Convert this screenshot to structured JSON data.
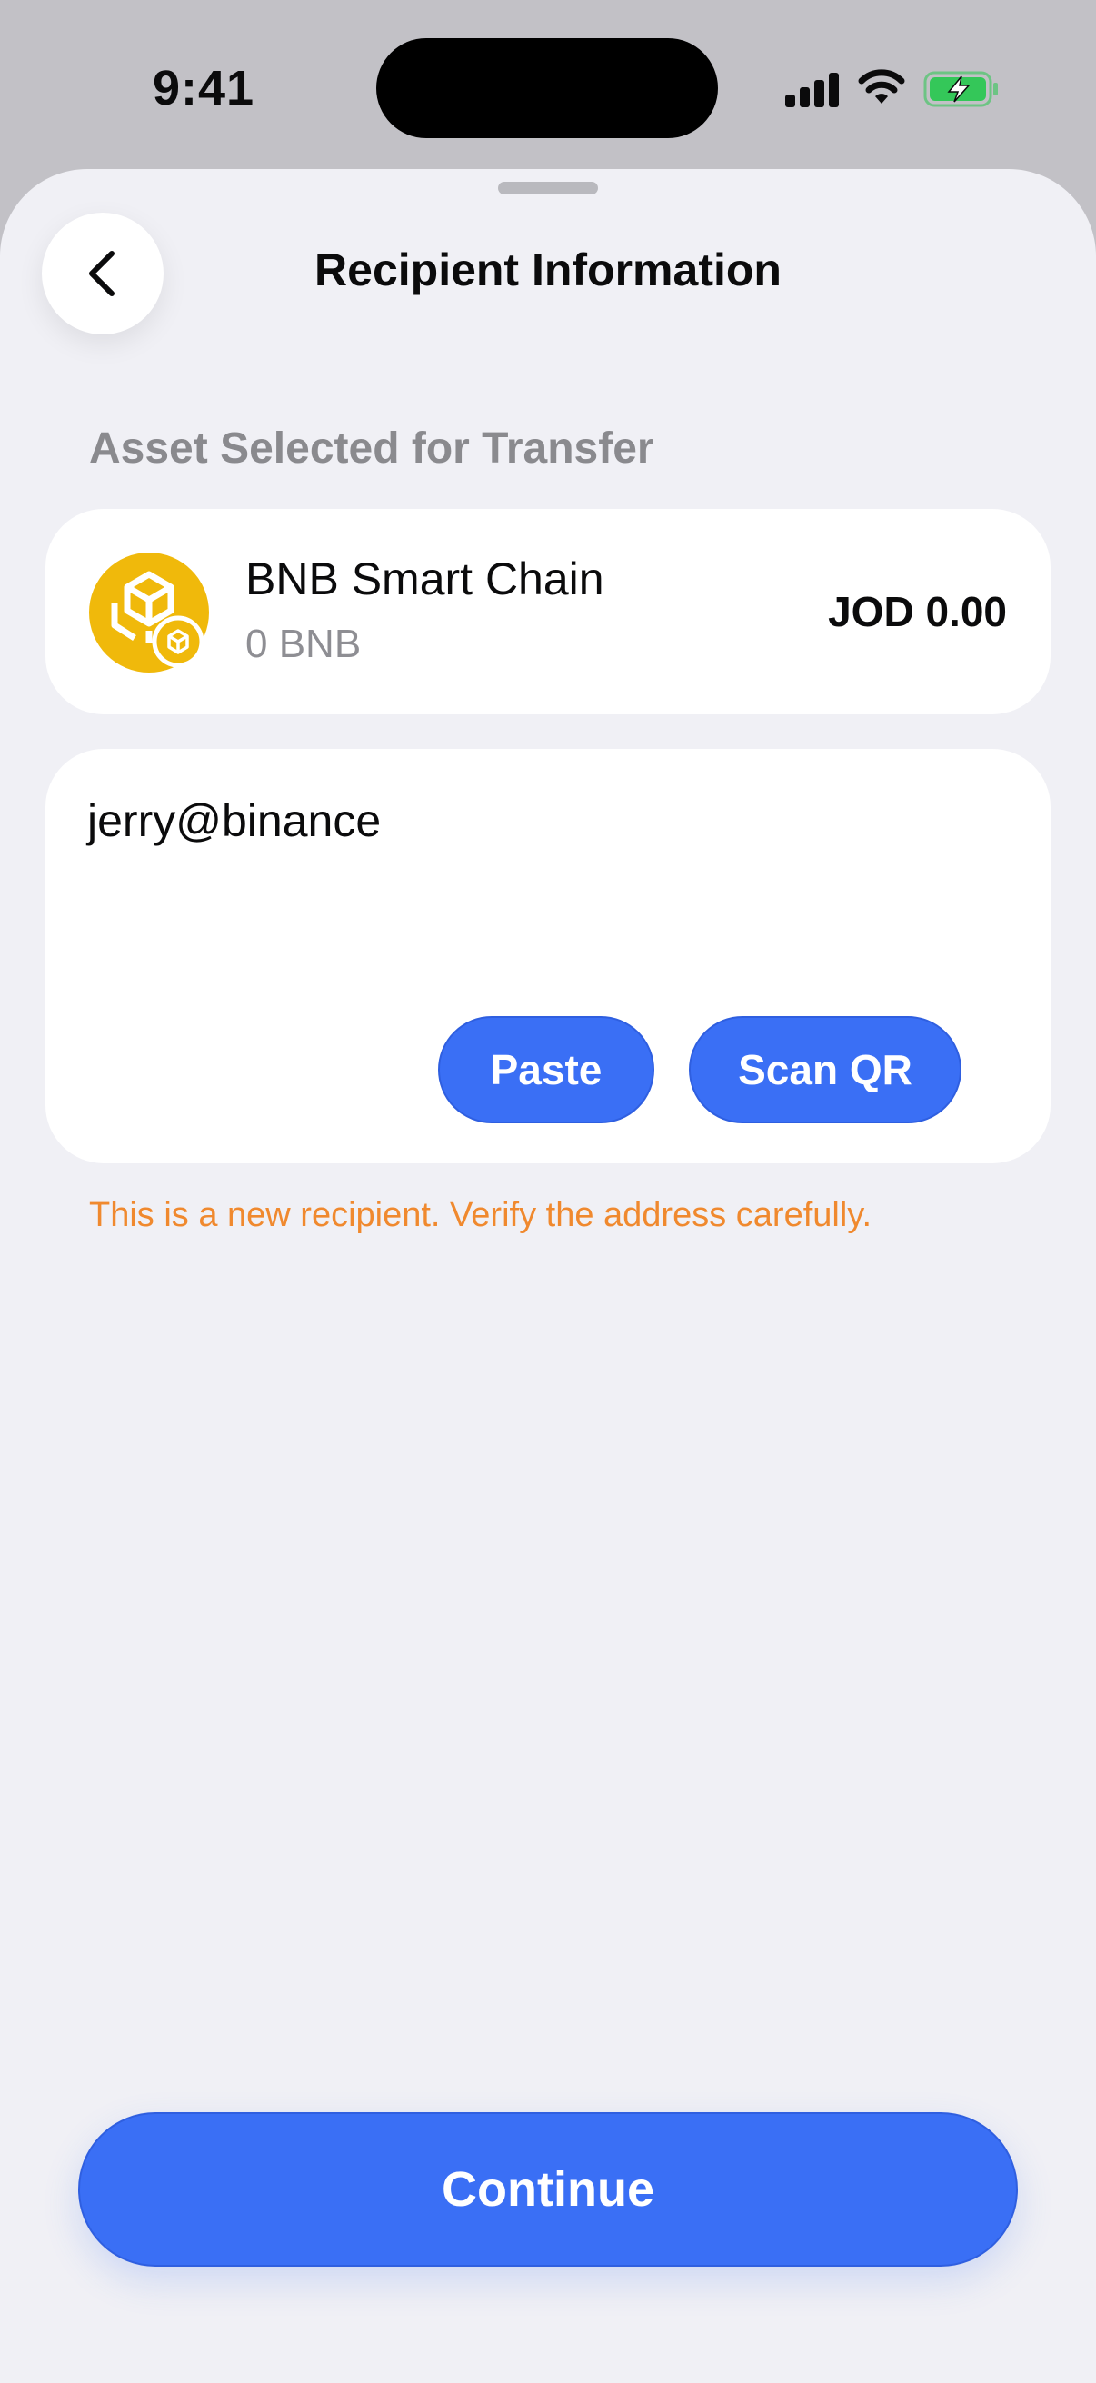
{
  "status_bar": {
    "time": "9:41"
  },
  "header": {
    "title": "Recipient Information",
    "back_icon": "chevron-left-icon"
  },
  "asset_section": {
    "label": "Asset Selected for Transfer",
    "asset": {
      "name": "BNB Smart Chain",
      "balance": "0 BNB",
      "fiat_value": "JOD 0.00",
      "logo_icon": "bnb-logo-icon",
      "logo_color": "#f0b90b"
    }
  },
  "recipient": {
    "address_value": "jerry@binance",
    "paste_label": "Paste",
    "scan_label": "Scan QR"
  },
  "warning_text": "This is a new recipient. Verify the address carefully.",
  "continue_label": "Continue",
  "colors": {
    "primary": "#3a6ff5",
    "warning": "#f0892e",
    "background": "#f0f0f5"
  }
}
